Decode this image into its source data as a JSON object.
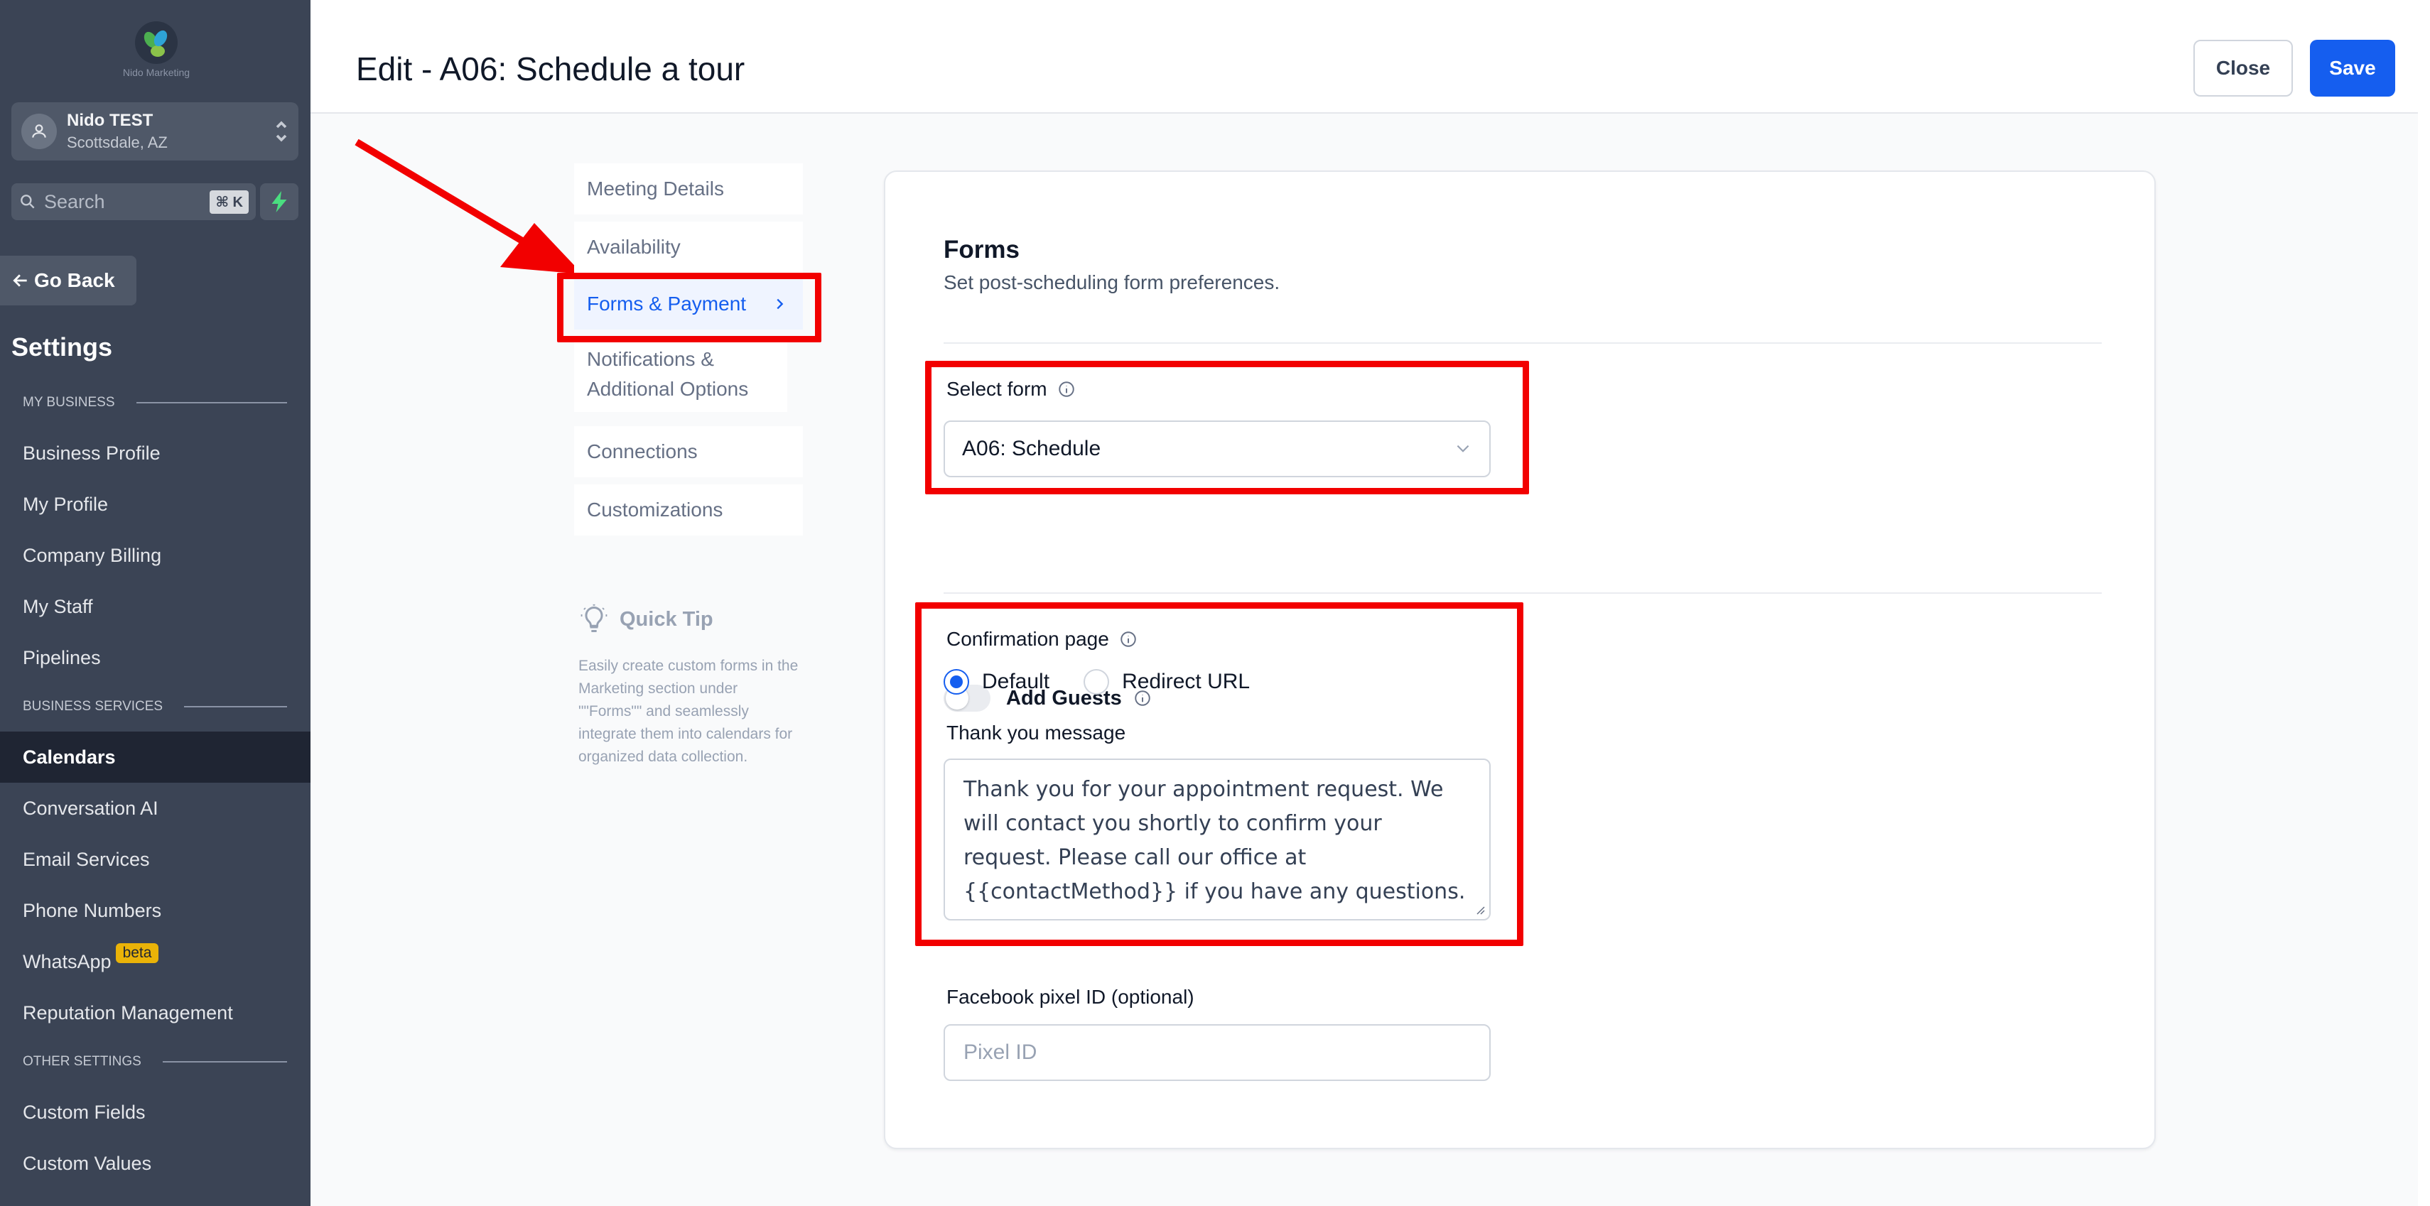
{
  "brand": {
    "logo_text": "Nido Marketing"
  },
  "location": {
    "name": "Nido TEST",
    "city": "Scottsdale, AZ"
  },
  "search": {
    "placeholder": "Search",
    "shortcut": "⌘ K"
  },
  "sidebar": {
    "go_back": "Go Back",
    "title": "Settings",
    "sections": [
      {
        "label": "MY BUSINESS"
      },
      {
        "label": "BUSINESS SERVICES"
      },
      {
        "label": "OTHER SETTINGS"
      }
    ],
    "items": [
      {
        "label": "Business Profile"
      },
      {
        "label": "My Profile"
      },
      {
        "label": "Company Billing"
      },
      {
        "label": "My Staff"
      },
      {
        "label": "Pipelines"
      },
      {
        "label": "Calendars",
        "active": true
      },
      {
        "label": "Conversation AI"
      },
      {
        "label": "Email Services"
      },
      {
        "label": "Phone Numbers"
      },
      {
        "label": "WhatsApp",
        "badge": "beta"
      },
      {
        "label": "Reputation Management"
      },
      {
        "label": "Custom Fields"
      },
      {
        "label": "Custom Values"
      }
    ]
  },
  "header": {
    "title": "Edit - A06: Schedule a tour",
    "close_label": "Close",
    "save_label": "Save"
  },
  "subnav": {
    "items": [
      {
        "label": "Meeting Details"
      },
      {
        "label": "Availability"
      },
      {
        "label": "Forms & Payment",
        "active": true
      },
      {
        "label": "Notifications & Additional Options"
      },
      {
        "label": "Connections"
      },
      {
        "label": "Customizations"
      }
    ]
  },
  "quick_tip": {
    "title": "Quick Tip",
    "body": "Easily create custom forms in the Marketing section under \"\"Forms\"\" and seamlessly integrate them into calendars for organized data collection."
  },
  "forms": {
    "title": "Forms",
    "subtitle": "Set post-scheduling form preferences.",
    "select_form_label": "Select form",
    "select_form_value": "A06: Schedule",
    "add_guests_label": "Add Guests",
    "add_guests_enabled": false,
    "confirmation_label": "Confirmation page",
    "confirmation_options": [
      "Default",
      "Redirect URL"
    ],
    "confirmation_selected": "Default",
    "thank_you_label": "Thank you message",
    "thank_you_message": "Thank you for your appointment request. We will contact you shortly to confirm your request. Please call our office at {{contactMethod}} if you have any questions.",
    "pixel_label": "Facebook pixel ID (optional)",
    "pixel_placeholder": "Pixel ID"
  },
  "colors": {
    "highlight": "#f20000",
    "accent": "#155eef",
    "sidebar": "#3b4455"
  }
}
